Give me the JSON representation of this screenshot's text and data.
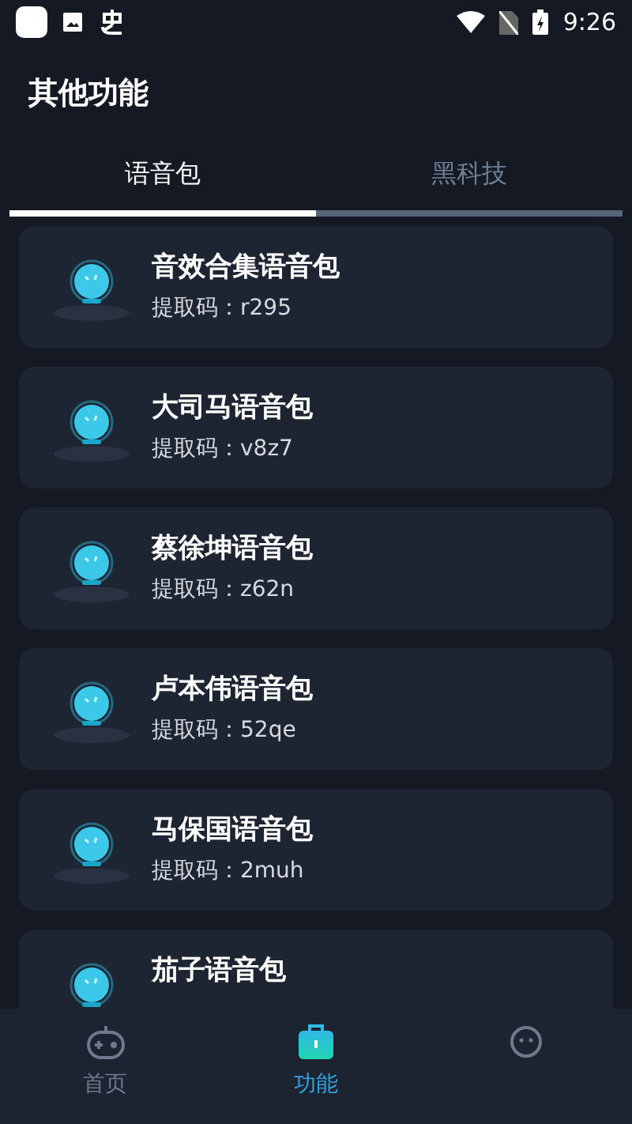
{
  "status_bar": {
    "time": "9:26"
  },
  "title": "其他功能",
  "tabs": [
    {
      "label": "语音包",
      "selected": true
    },
    {
      "label": "黑科技",
      "selected": false
    }
  ],
  "items": [
    {
      "name": "音效合集语音包",
      "code": "提取码：r295"
    },
    {
      "name": "大司马语音包",
      "code": "提取码：v8z7"
    },
    {
      "name": "蔡徐坤语音包",
      "code": "提取码：z62n"
    },
    {
      "name": "卢本伟语音包",
      "code": "提取码：52qe"
    },
    {
      "name": "马保国语音包",
      "code": "提取码：2muh"
    },
    {
      "name": "茄子语音包"
    }
  ],
  "nav": [
    {
      "kind": "gamepad",
      "label": "首页",
      "selected": false
    },
    {
      "kind": "briefcase",
      "label": "功能",
      "selected": true
    },
    {
      "kind": "robot",
      "selected": false
    }
  ]
}
